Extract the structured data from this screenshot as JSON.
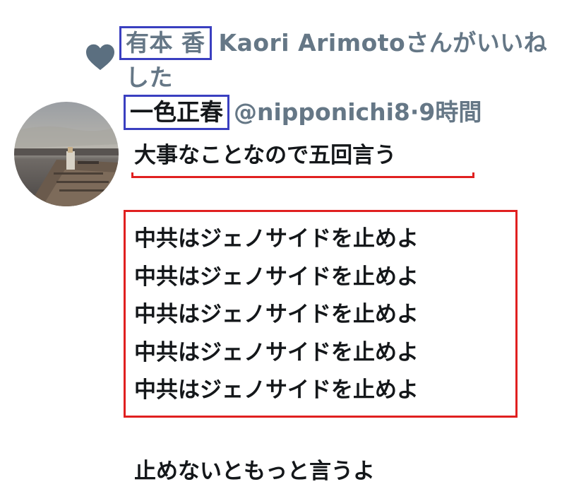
{
  "like_notice": {
    "icon": "heart-icon",
    "liker_name": "有本 香",
    "liker_rest": "Kaori Arimotoさんがいいねした",
    "color": "#657786"
  },
  "tweet": {
    "author": {
      "display_name": "一色正春",
      "handle": "@nipponichi8",
      "separator": "·",
      "time": "9時間"
    },
    "lead_text": "大事なことなので五回言う",
    "repeated_lines": [
      "中共はジェノサイドを止めよ",
      "中共はジェノサイドを止めよ",
      "中共はジェノサイドを止めよ",
      "中共はジェノサイドを止めよ",
      "中共はジェノサイドを止めよ"
    ],
    "closing_text": "止めないともっと言うよ"
  },
  "annotation_colors": {
    "blue": "#3a3fc0",
    "red": "#e02020"
  }
}
